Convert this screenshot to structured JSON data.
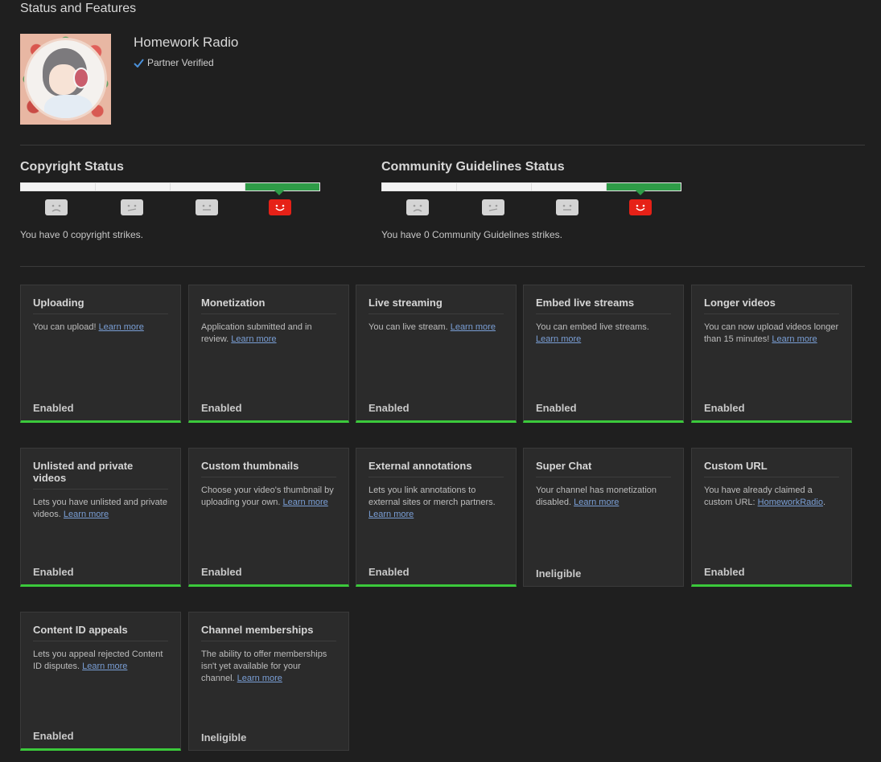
{
  "page_title": "Status and Features",
  "channel": {
    "name": "Homework Radio",
    "verified_label": "Partner Verified"
  },
  "copyright": {
    "title": "Copyright Status",
    "strikes_text": "You have 0 copyright strikes.",
    "level": 4,
    "levels": 4
  },
  "community": {
    "title": "Community Guidelines Status",
    "strikes_text": "You have 0 Community Guidelines strikes.",
    "level": 4,
    "levels": 4
  },
  "colors": {
    "enabled_bar": "#3bc93b",
    "active_segment": "#2e9c47",
    "active_face": "#e62117",
    "link": "#7a9fd6"
  },
  "features": [
    {
      "title": "Uploading",
      "text": "You can upload! ",
      "link": "Learn more",
      "text_after": "",
      "status": "Enabled",
      "enabled": true
    },
    {
      "title": "Monetization",
      "text": "Application submitted and in review. ",
      "link": "Learn more",
      "text_after": "",
      "status": "Enabled",
      "enabled": true
    },
    {
      "title": "Live streaming",
      "text": "You can live stream. ",
      "link": "Learn more",
      "text_after": "",
      "status": "Enabled",
      "enabled": true
    },
    {
      "title": "Embed live streams",
      "text": "You can embed live streams. ",
      "link": "Learn more",
      "text_after": "",
      "status": "Enabled",
      "enabled": true
    },
    {
      "title": "Longer videos",
      "text": "You can now upload videos longer than 15 minutes! ",
      "link": "Learn more",
      "text_after": "",
      "status": "Enabled",
      "enabled": true
    },
    {
      "title": "Unlisted and private videos",
      "text": "Lets you have unlisted and private videos. ",
      "link": "Learn more",
      "text_after": "",
      "status": "Enabled",
      "enabled": true
    },
    {
      "title": "Custom thumbnails",
      "text": "Choose your video's thumbnail by uploading your own. ",
      "link": "Learn more",
      "text_after": "",
      "status": "Enabled",
      "enabled": true
    },
    {
      "title": "External annotations",
      "text": "Lets you link annotations to external sites or merch partners. ",
      "link": "Learn more",
      "text_after": "",
      "status": "Enabled",
      "enabled": true
    },
    {
      "title": "Super Chat",
      "text": "Your channel has monetization disabled. ",
      "link": "Learn more",
      "text_after": "",
      "status": "Ineligible",
      "enabled": false
    },
    {
      "title": "Custom URL",
      "text": "You have already claimed a custom URL: ",
      "link": "HomeworkRadio",
      "text_after": ".",
      "status": "Enabled",
      "enabled": true
    },
    {
      "title": "Content ID appeals",
      "text": "Lets you appeal rejected Content ID disputes. ",
      "link": "Learn more",
      "text_after": "",
      "status": "Enabled",
      "enabled": true
    },
    {
      "title": "Channel memberships",
      "text": "The ability to offer memberships isn't yet available for your channel. ",
      "link": "Learn more",
      "text_after": "",
      "status": "Ineligible",
      "enabled": false
    }
  ]
}
